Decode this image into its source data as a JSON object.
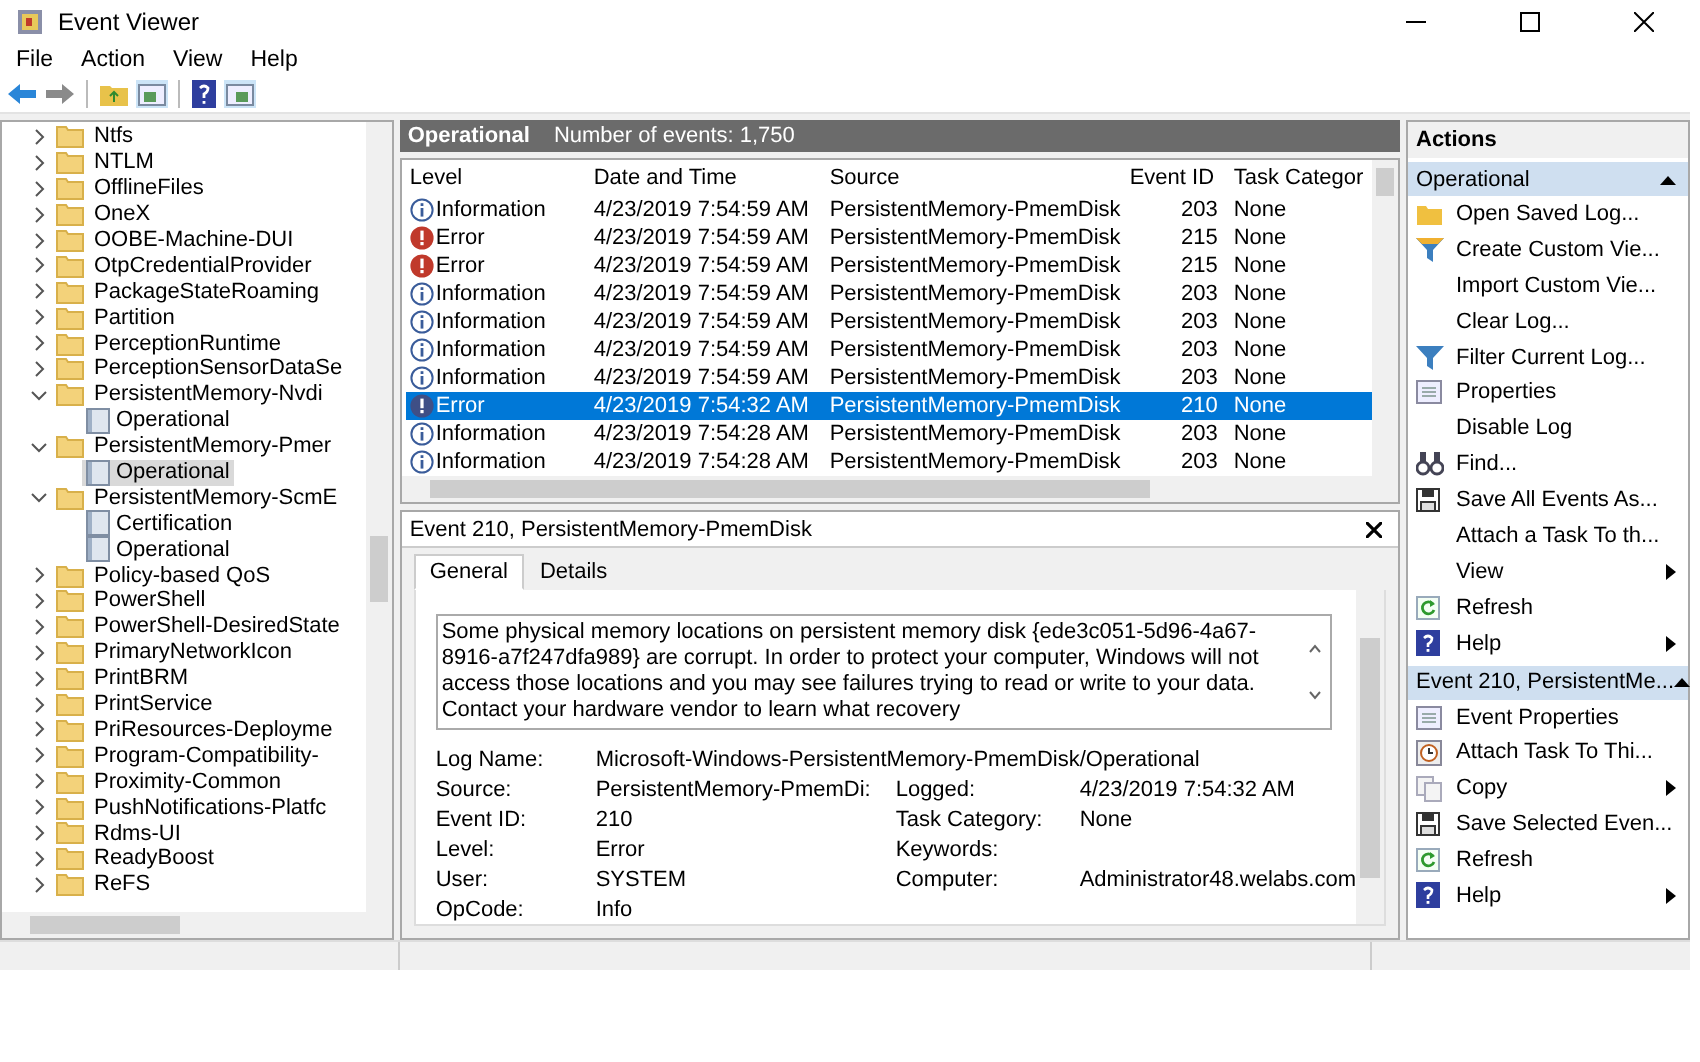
{
  "window": {
    "title": "Event Viewer"
  },
  "menu": [
    "File",
    "Action",
    "View",
    "Help"
  ],
  "tree": [
    {
      "label": "Ntfs",
      "kind": "folder",
      "expanded": false,
      "selected": false
    },
    {
      "label": "NTLM",
      "kind": "folder",
      "expanded": false,
      "selected": false
    },
    {
      "label": "OfflineFiles",
      "kind": "folder",
      "expanded": false,
      "selected": false
    },
    {
      "label": "OneX",
      "kind": "folder",
      "expanded": false,
      "selected": false
    },
    {
      "label": "OOBE-Machine-DUI",
      "kind": "folder",
      "expanded": false,
      "selected": false
    },
    {
      "label": "OtpCredentialProvider",
      "kind": "folder",
      "expanded": false,
      "selected": false
    },
    {
      "label": "PackageStateRoaming",
      "kind": "folder",
      "expanded": false,
      "selected": false
    },
    {
      "label": "Partition",
      "kind": "folder",
      "expanded": false,
      "selected": false
    },
    {
      "label": "PerceptionRuntime",
      "kind": "folder",
      "expanded": false,
      "selected": false
    },
    {
      "label": "PerceptionSensorDataSe",
      "kind": "folder",
      "expanded": false,
      "selected": false
    },
    {
      "label": "PersistentMemory-Nvdi",
      "kind": "folder",
      "expanded": true,
      "selected": false,
      "children": [
        {
          "label": "Operational",
          "kind": "log",
          "selected": false
        }
      ]
    },
    {
      "label": "PersistentMemory-Pmer",
      "kind": "folder",
      "expanded": true,
      "selected": false,
      "children": [
        {
          "label": "Operational",
          "kind": "log",
          "selected": true
        }
      ]
    },
    {
      "label": "PersistentMemory-ScmE",
      "kind": "folder",
      "expanded": true,
      "selected": false,
      "children": [
        {
          "label": "Certification",
          "kind": "log",
          "selected": false
        },
        {
          "label": "Operational",
          "kind": "log",
          "selected": false
        }
      ]
    },
    {
      "label": "Policy-based QoS",
      "kind": "folder",
      "expanded": false,
      "selected": false
    },
    {
      "label": "PowerShell",
      "kind": "folder",
      "expanded": false,
      "selected": false
    },
    {
      "label": "PowerShell-DesiredState",
      "kind": "folder",
      "expanded": false,
      "selected": false
    },
    {
      "label": "PrimaryNetworkIcon",
      "kind": "folder",
      "expanded": false,
      "selected": false
    },
    {
      "label": "PrintBRM",
      "kind": "folder",
      "expanded": false,
      "selected": false
    },
    {
      "label": "PrintService",
      "kind": "folder",
      "expanded": false,
      "selected": false
    },
    {
      "label": "PriResources-Deployme",
      "kind": "folder",
      "expanded": false,
      "selected": false
    },
    {
      "label": "Program-Compatibility-",
      "kind": "folder",
      "expanded": false,
      "selected": false
    },
    {
      "label": "Proximity-Common",
      "kind": "folder",
      "expanded": false,
      "selected": false
    },
    {
      "label": "PushNotifications-Platfc",
      "kind": "folder",
      "expanded": false,
      "selected": false
    },
    {
      "label": "Rdms-UI",
      "kind": "folder",
      "expanded": false,
      "selected": false
    },
    {
      "label": "ReadyBoost",
      "kind": "folder",
      "expanded": false,
      "selected": false
    },
    {
      "label": "ReFS",
      "kind": "folder",
      "expanded": false,
      "selected": false
    }
  ],
  "log_header": {
    "name": "Operational",
    "count": "Number of events: 1,750"
  },
  "events": {
    "columns": [
      "Level",
      "Date and Time",
      "Source",
      "Event ID",
      "Task Categor"
    ],
    "rows": [
      {
        "kind": "information",
        "level": "Information",
        "date": "4/23/2019 7:54:59 AM",
        "source": "PersistentMemory-PmemDisk",
        "id": "203",
        "category": "None",
        "selected": false
      },
      {
        "kind": "error",
        "level": "Error",
        "date": "4/23/2019 7:54:59 AM",
        "source": "PersistentMemory-PmemDisk",
        "id": "215",
        "category": "None",
        "selected": false
      },
      {
        "kind": "error",
        "level": "Error",
        "date": "4/23/2019 7:54:59 AM",
        "source": "PersistentMemory-PmemDisk",
        "id": "215",
        "category": "None",
        "selected": false
      },
      {
        "kind": "information",
        "level": "Information",
        "date": "4/23/2019 7:54:59 AM",
        "source": "PersistentMemory-PmemDisk",
        "id": "203",
        "category": "None",
        "selected": false
      },
      {
        "kind": "information",
        "level": "Information",
        "date": "4/23/2019 7:54:59 AM",
        "source": "PersistentMemory-PmemDisk",
        "id": "203",
        "category": "None",
        "selected": false
      },
      {
        "kind": "information",
        "level": "Information",
        "date": "4/23/2019 7:54:59 AM",
        "source": "PersistentMemory-PmemDisk",
        "id": "203",
        "category": "None",
        "selected": false
      },
      {
        "kind": "information",
        "level": "Information",
        "date": "4/23/2019 7:54:59 AM",
        "source": "PersistentMemory-PmemDisk",
        "id": "203",
        "category": "None",
        "selected": false
      },
      {
        "kind": "error",
        "level": "Error",
        "date": "4/23/2019 7:54:32 AM",
        "source": "PersistentMemory-PmemDisk",
        "id": "210",
        "category": "None",
        "selected": true
      },
      {
        "kind": "information",
        "level": "Information",
        "date": "4/23/2019 7:54:28 AM",
        "source": "PersistentMemory-PmemDisk",
        "id": "203",
        "category": "None",
        "selected": false
      },
      {
        "kind": "information",
        "level": "Information",
        "date": "4/23/2019 7:54:28 AM",
        "source": "PersistentMemory-PmemDisk",
        "id": "203",
        "category": "None",
        "selected": false
      }
    ]
  },
  "detail": {
    "title": "Event 210, PersistentMemory-PmemDisk",
    "tabs": [
      {
        "label": "General",
        "selected": true
      },
      {
        "label": "Details",
        "selected": false
      }
    ],
    "description": "Some physical memory locations on persistent memory disk {ede3c051-5d96-4a67-8916-a7f247dfa989} are corrupt. In order to protect your computer, Windows will not access those locations and you may see failures trying to read or write to your data. Contact your hardware vendor to learn what recovery",
    "fields": [
      {
        "left": {
          "label": "Log Name:",
          "value": "Microsoft-Windows-PersistentMemory-PmemDisk/Operational"
        }
      },
      {
        "left": {
          "label": "Source:",
          "value": "PersistentMemory-PmemDi:"
        },
        "right": {
          "label": "Logged:",
          "value": "4/23/2019 7:54:32 AM"
        }
      },
      {
        "left": {
          "label": "Event ID:",
          "value": "210"
        },
        "right": {
          "label": "Task Category:",
          "value": "None"
        }
      },
      {
        "left": {
          "label": "Level:",
          "value": "Error"
        },
        "right": {
          "label": "Keywords:"
        }
      },
      {
        "left": {
          "label": "User:",
          "value": "SYSTEM"
        },
        "right": {
          "label": "Computer:",
          "value": "Administrator48.welabs.com"
        }
      },
      {
        "left": {
          "label": "OpCode:",
          "value": "Info"
        }
      }
    ]
  },
  "actions": {
    "title": "Actions",
    "sections": [
      {
        "title": "Operational",
        "expanded": true,
        "items": [
          {
            "label": "Open Saved Log...",
            "kind": "folder"
          },
          {
            "label": "Create Custom Vie...",
            "kind": "funnel"
          },
          {
            "label": "Import Custom Vie...",
            "kind": "plain"
          },
          {
            "label": "Clear Log...",
            "kind": "plain"
          },
          {
            "label": "Filter Current Log...",
            "kind": "funnel"
          },
          {
            "label": "Properties",
            "kind": "sheet"
          },
          {
            "label": "Disable Log",
            "kind": "plain"
          },
          {
            "label": "Find...",
            "kind": "binoculars"
          },
          {
            "label": "Save All Events As...",
            "kind": "disk"
          },
          {
            "label": "Attach a Task To th...",
            "kind": "plain"
          },
          {
            "label": "View",
            "kind": "plain",
            "submenu": true
          },
          {
            "label": "Refresh",
            "kind": "refresh"
          },
          {
            "label": "Help",
            "kind": "help",
            "submenu": true
          }
        ]
      },
      {
        "title": "Event 210, PersistentMe...",
        "expanded": true,
        "items": [
          {
            "label": "Event Properties",
            "kind": "sheet"
          },
          {
            "label": "Attach Task To Thi...",
            "kind": "clock"
          },
          {
            "label": "Copy",
            "kind": "copy",
            "submenu": true
          },
          {
            "label": "Save Selected Even...",
            "kind": "disk"
          },
          {
            "label": "Refresh",
            "kind": "refresh"
          },
          {
            "label": "Help",
            "kind": "help",
            "submenu": true
          }
        ]
      }
    ]
  }
}
